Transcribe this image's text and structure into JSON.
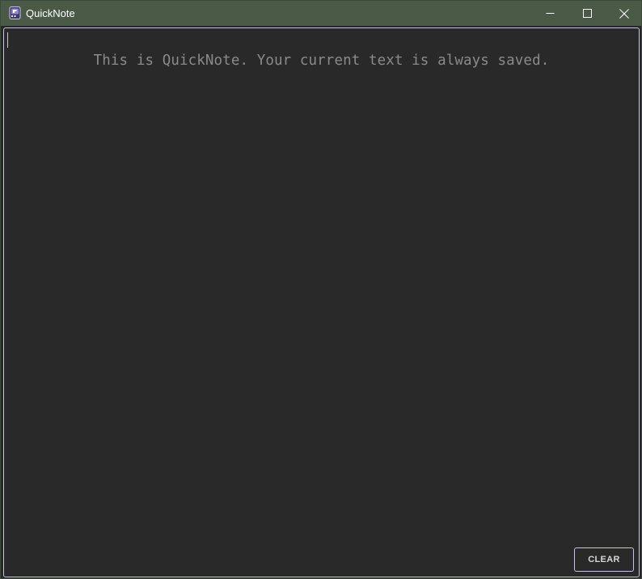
{
  "window": {
    "title": "QuickNote",
    "icon": "notepad-app-icon",
    "controls": {
      "minimize_icon": "minimize-icon",
      "maximize_icon": "maximize-icon",
      "close_icon": "close-icon"
    }
  },
  "editor": {
    "text": "",
    "placeholder": "This is QuickNote. Your current text is always saved."
  },
  "actions": {
    "clear_label": "CLEAR"
  },
  "colors": {
    "titlebar": "#4a5a47",
    "background": "#292929",
    "accent_border": "#c7c2e6",
    "placeholder": "#8a8a8a"
  }
}
